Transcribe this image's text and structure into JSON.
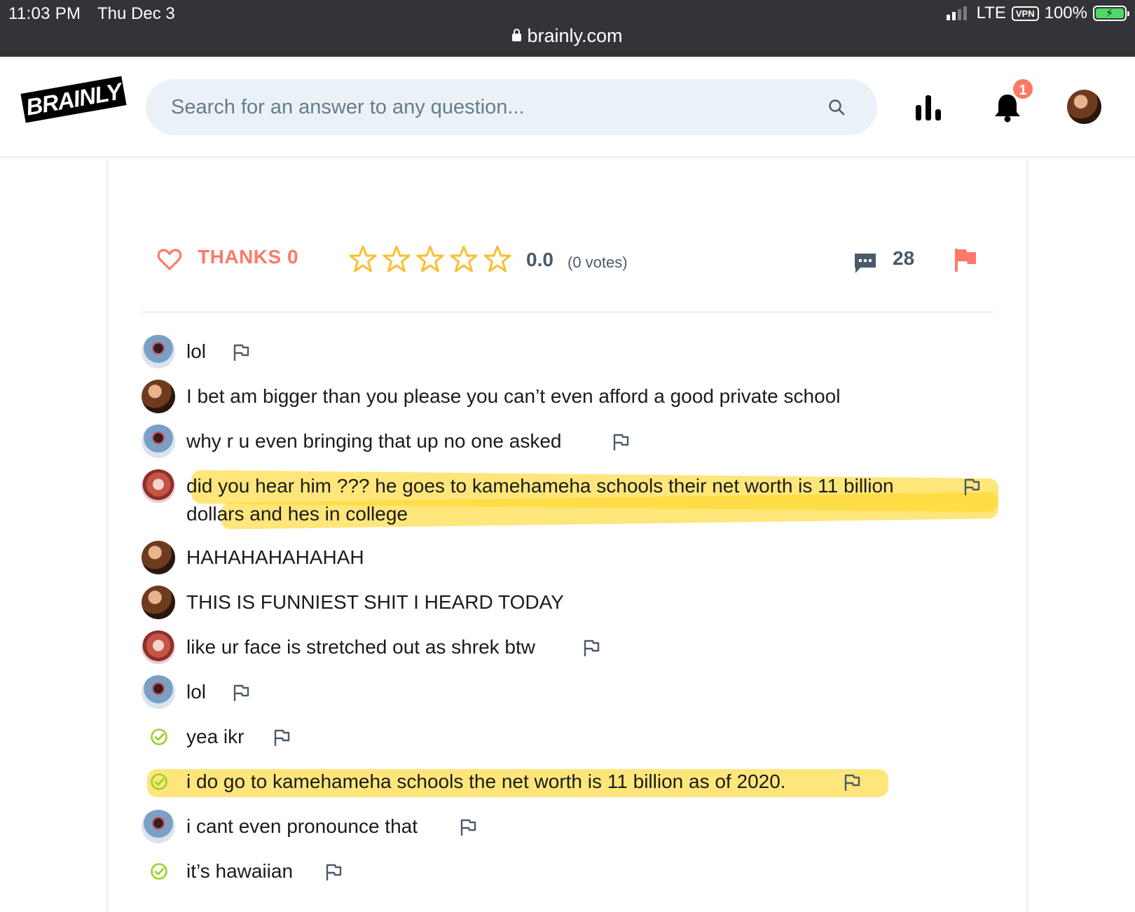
{
  "status_bar": {
    "time": "11:03 PM",
    "date": "Thu Dec 3",
    "network": "LTE",
    "vpn": "VPN",
    "battery": "100%",
    "url": "brainly.com"
  },
  "header": {
    "logo": "BRAINLY",
    "search_placeholder": "Search for an answer to any question...",
    "notification_count": "1"
  },
  "actions": {
    "thanks_label": "THANKS 0",
    "rating": "0.0",
    "votes": "(0 votes)",
    "stars_filled": 0,
    "stars_total": 5,
    "comment_count": "28"
  },
  "colors": {
    "accent": "#ff7968",
    "star": "#fbbe2e",
    "check": "#9bd12a",
    "icon_gray": "#4a5a69",
    "highlight": "#ffd628",
    "search_bg": "#ebf2f7"
  },
  "comments": [
    {
      "avatar": "anime-dark",
      "text": "lol",
      "flag": true
    },
    {
      "avatar": "photo-brown",
      "text": "I bet am bigger than you please you can’t even afford a good private school",
      "flag": false
    },
    {
      "avatar": "anime-dark",
      "text": "why r u even bringing that up no one asked",
      "flag": true
    },
    {
      "avatar": "anime-red",
      "text_line1": "did you hear him ??? he goes to kamehameha schools their net worth is 11 billion",
      "text_line2": "dollars and hes in college",
      "flag": true,
      "highlighted": true
    },
    {
      "avatar": "photo-brown",
      "text": "HAHAHAHAHAHAH",
      "flag": false
    },
    {
      "avatar": "photo-brown",
      "text": "THIS IS FUNNIEST SHIT I HEARD TODAY",
      "flag": false
    },
    {
      "avatar": "anime-red",
      "text": "like ur face is stretched out as shrek btw",
      "flag": true
    },
    {
      "avatar": "anime-dark",
      "text": "lol",
      "flag": true
    },
    {
      "avatar": "check",
      "text": "yea ikr",
      "flag": true
    },
    {
      "avatar": "check",
      "text": "i do go to kamehameha schools the net worth is 11 billion as of 2020.",
      "flag": true,
      "highlighted": true
    },
    {
      "avatar": "anime-dark",
      "text": "i cant even pronounce that",
      "flag": true
    },
    {
      "avatar": "check",
      "text": "it’s hawaiian",
      "flag": true
    }
  ]
}
